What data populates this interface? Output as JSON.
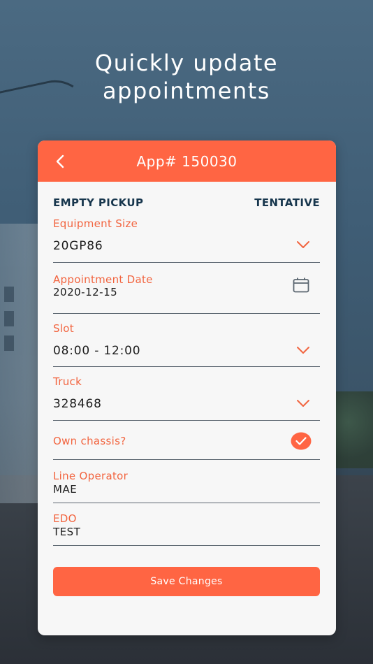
{
  "promo": {
    "line1": "Quickly update",
    "line2": "appointments"
  },
  "header": {
    "title": "App# 150030",
    "back_icon": "chevron-left-icon"
  },
  "type_label": "EMPTY PICKUP",
  "status_label": "TENTATIVE",
  "fields": {
    "equipment_size": {
      "label": "Equipment Size",
      "value": "20GP86"
    },
    "appointment_date": {
      "label": "Appointment Date",
      "value": "2020-12-15"
    },
    "slot": {
      "label": "Slot",
      "value": "08:00 - 12:00"
    },
    "truck": {
      "label": "Truck",
      "value": "328468"
    },
    "own_chassis": {
      "label": "Own chassis?",
      "checked": true
    },
    "line_operator": {
      "label": "Line Operator",
      "value": "MAE"
    },
    "edo": {
      "label": "EDO",
      "value": "TEST"
    }
  },
  "save_label": "Save Changes",
  "colors": {
    "accent": "#ff6543",
    "heading": "#17364d",
    "label": "#f2643f",
    "card": "#f7f7f7"
  }
}
